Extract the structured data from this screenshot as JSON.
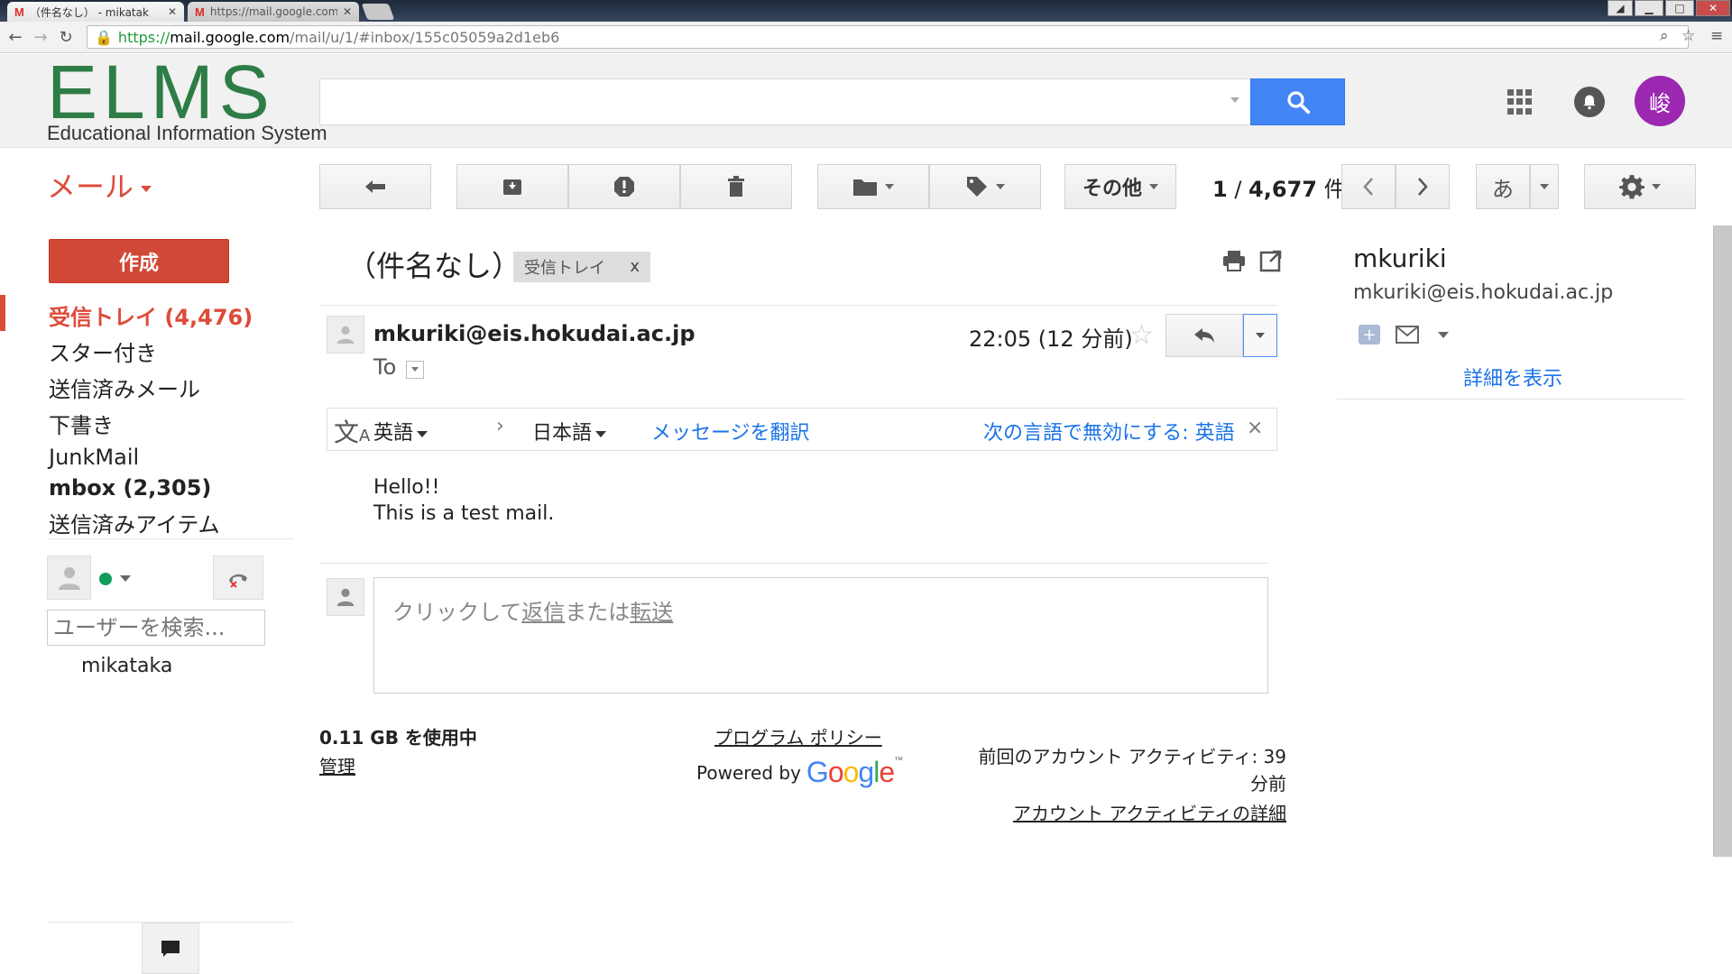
{
  "browser": {
    "tabs": [
      {
        "title": "（件名なし） - mikatak",
        "active": true
      },
      {
        "title": "https://mail.google.com",
        "active": false
      }
    ],
    "url": {
      "scheme": "https://",
      "host": "mail.google.com",
      "path": "/mail/u/1/#inbox/155c05059a2d1eb6"
    }
  },
  "header": {
    "logo_main": "ELMS",
    "logo_sub": "Educational Information System",
    "avatar_initial": "峻"
  },
  "toolbar": {
    "mail_label": "メール",
    "more_label": "その他",
    "page_range": "1",
    "page_sep": " / ",
    "page_total": "4,677",
    "page_unit": " 件",
    "input_tool": "あ"
  },
  "nav": {
    "compose": "作成",
    "items": [
      {
        "label": "受信トレイ (4,476)"
      },
      {
        "label": "スター付き"
      },
      {
        "label": "送信済みメール"
      },
      {
        "label": "下書き"
      },
      {
        "label": "JunkMail"
      },
      {
        "label": "mbox (2,305)"
      },
      {
        "label": "送信済みアイテム"
      }
    ],
    "user_search_placeholder": "ユーザーを検索...",
    "contact": "mikataka"
  },
  "message": {
    "subject": "（件名なし）",
    "label_chip": "受信トレイ",
    "label_close": "x",
    "sender": "mkuriki@eis.hokudai.ac.jp",
    "recipient_label": "To",
    "time": "22:05 (12 分前)",
    "translate": {
      "from": "英語",
      "to": "日本語",
      "translate_link": "メッセージを翻訳",
      "disable_link": "次の言語で無効にする: 英語",
      "close": "×"
    },
    "body_lines": [
      "Hello!!",
      "This is a test mail."
    ],
    "reply_prompt_prefix": "クリックして",
    "reply_word": "返信",
    "reply_middle": "または",
    "forward_word": "転送"
  },
  "footer": {
    "storage": "0.11 GB を使用中",
    "manage": "管理",
    "policy": "プログラム ポリシー",
    "powered_by": "Powered by",
    "google": "Google",
    "activity_text": "前回のアカウント アクティビティ: 39 分前",
    "activity_link": "アカウント アクティビティの詳細"
  },
  "contact_panel": {
    "name": "mkuriki",
    "email": "mkuriki@eis.hokudai.ac.jp",
    "details_link": "詳細を表示"
  },
  "colors": {
    "accent_red": "#dd4b39",
    "compose_red": "#d14836",
    "search_blue": "#4285f4",
    "link_blue": "#1a73e8",
    "logo_green": "#2e7d46",
    "avatar_purple": "#9c27b0"
  }
}
